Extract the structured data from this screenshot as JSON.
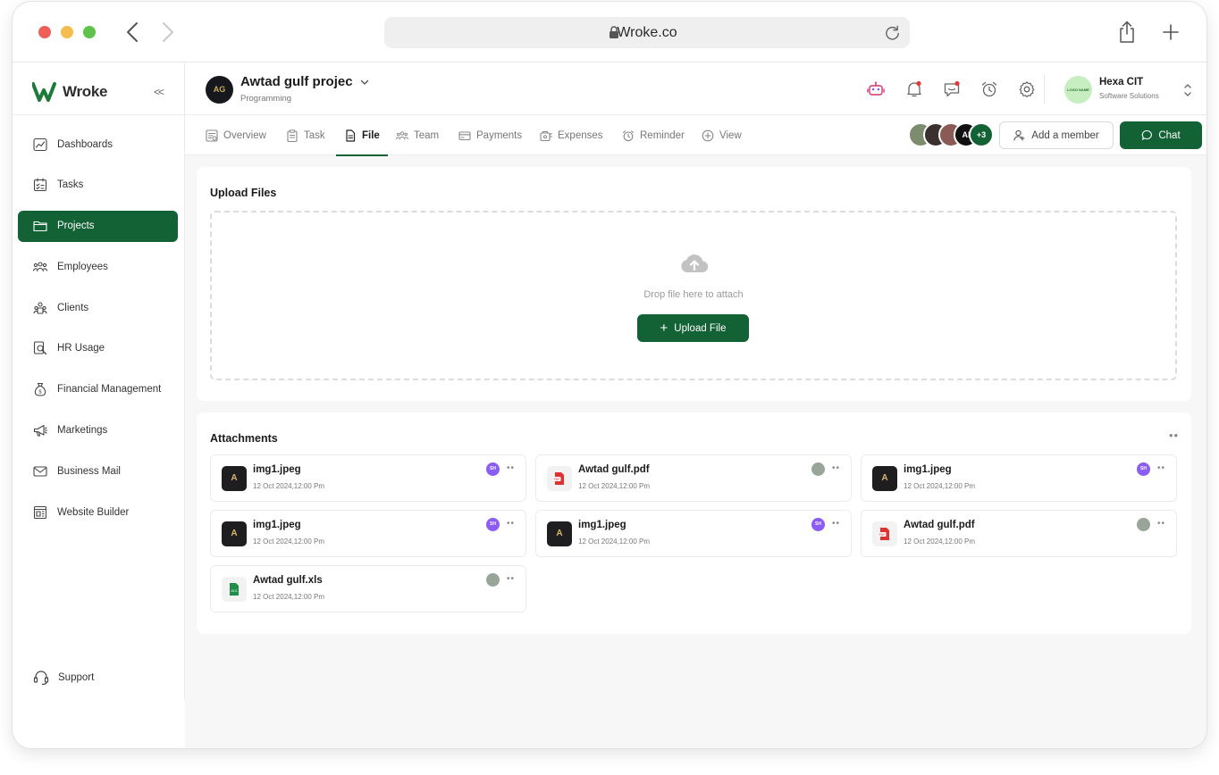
{
  "browser": {
    "url": "Wroke.co"
  },
  "sidebar": {
    "brand": "Wroke",
    "collapse_label": "<<",
    "items": [
      {
        "label": "Dashboards",
        "icon": "dashboard-icon"
      },
      {
        "label": "Tasks",
        "icon": "tasks-icon"
      },
      {
        "label": "Projects",
        "icon": "folder-icon",
        "active": true
      },
      {
        "label": "Employees",
        "icon": "employees-icon"
      },
      {
        "label": "Clients",
        "icon": "clients-icon"
      },
      {
        "label": "HR Usage",
        "icon": "hr-usage-icon"
      },
      {
        "label": "Financial Management",
        "icon": "money-bag-icon"
      },
      {
        "label": "Marketings",
        "icon": "megaphone-icon"
      },
      {
        "label": "Business Mail",
        "icon": "mail-icon"
      },
      {
        "label": "Website Builder",
        "icon": "website-icon"
      }
    ],
    "support_label": "Support"
  },
  "header": {
    "project_logo_text": "AG",
    "project_title": "Awtad gulf projec",
    "project_subtitle": "Programming",
    "company_name": "Hexa CIT",
    "company_subtitle": "Software Solutions",
    "company_logo_text": "LOGO NAME"
  },
  "tabs": [
    {
      "label": "Overview",
      "icon": "overview-icon"
    },
    {
      "label": "Task",
      "icon": "task-icon"
    },
    {
      "label": "File",
      "icon": "file-icon",
      "active": true
    },
    {
      "label": "Team",
      "icon": "team-icon"
    },
    {
      "label": "Payments",
      "icon": "payments-icon"
    },
    {
      "label": "Expenses",
      "icon": "expenses-icon"
    },
    {
      "label": "Reminder",
      "icon": "reminder-icon"
    },
    {
      "label": "View",
      "icon": "view-icon"
    }
  ],
  "members": {
    "visible_initials": "Al",
    "extra_count": "+3"
  },
  "actions": {
    "add_member": "Add a member",
    "chat": "Chat"
  },
  "upload": {
    "title": "Upload Files",
    "drop_text": "Drop file here to attach",
    "button": "Upload File"
  },
  "attachments": {
    "title": "Attachments",
    "files": [
      {
        "name": "img1.jpeg",
        "date": "12 Oct 2024,12:00 Pm",
        "type": "img",
        "owner": "SH"
      },
      {
        "name": "Awtad gulf.pdf",
        "date": "12 Oct 2024,12:00 Pm",
        "type": "pdf",
        "owner": ""
      },
      {
        "name": "img1.jpeg",
        "date": "12 Oct 2024,12:00 Pm",
        "type": "img",
        "owner": "SH"
      },
      {
        "name": "img1.jpeg",
        "date": "12 Oct 2024,12:00 Pm",
        "type": "img",
        "owner": "SH"
      },
      {
        "name": "img1.jpeg",
        "date": "12 Oct 2024,12:00 Pm",
        "type": "img",
        "owner": "SH"
      },
      {
        "name": "Awtad gulf.pdf",
        "date": "12 Oct 2024,12:00 Pm",
        "type": "pdf",
        "owner": ""
      },
      {
        "name": "Awtad gulf.xls",
        "date": "12 Oct 2024,12:00 Pm",
        "type": "xls",
        "owner": ""
      }
    ]
  },
  "colors": {
    "brand_green": "#136236",
    "owner_purple": "#8b5cf6",
    "notification_red": "#e53935"
  }
}
